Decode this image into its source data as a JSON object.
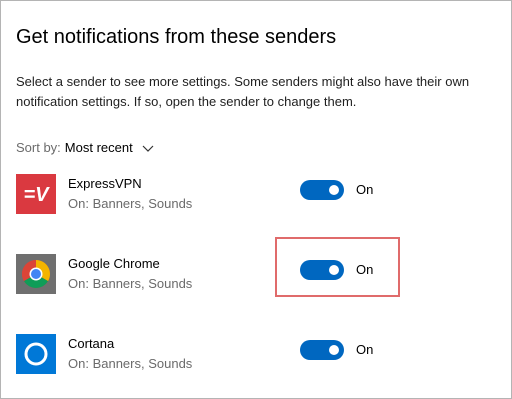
{
  "header": {
    "title": "Get notifications from these senders",
    "description": "Select a sender to see more settings. Some senders might also have their own notification settings. If so, open the sender to change them."
  },
  "sort": {
    "label": "Sort by:",
    "value": "Most recent"
  },
  "senders": [
    {
      "name": "ExpressVPN",
      "detail": "On: Banners, Sounds",
      "toggle_state": "On",
      "toggle_on": true,
      "icon": "expressvpn-icon",
      "color": "#da3940"
    },
    {
      "name": "Google Chrome",
      "detail": "On: Banners, Sounds",
      "toggle_state": "On",
      "toggle_on": true,
      "icon": "chrome-icon",
      "color": "#4285f4",
      "highlighted": true
    },
    {
      "name": "Cortana",
      "detail": "On: Banners, Sounds",
      "toggle_state": "On",
      "toggle_on": true,
      "icon": "cortana-icon",
      "color": "#0078d7"
    }
  ],
  "colors": {
    "accent": "#0067c0",
    "highlight": "#e06b6b"
  }
}
